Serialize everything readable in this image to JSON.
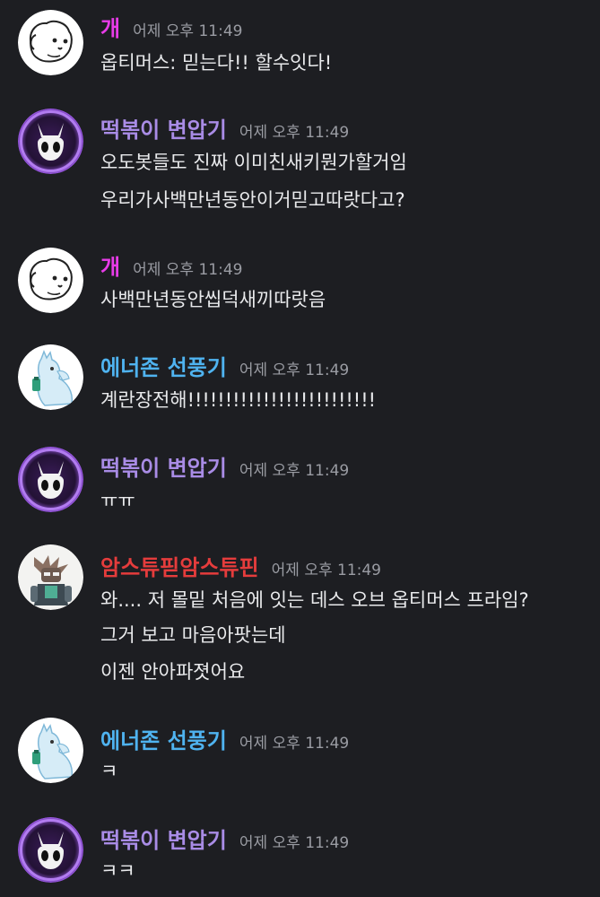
{
  "users": {
    "dog": {
      "name": "개",
      "color": "#e83ce8",
      "avatar_icon": "white-dog-face-icon"
    },
    "tteok": {
      "name": "떡볶이 변압기",
      "color": "#a98ce6",
      "avatar_icon": "hollow-knight-mask-icon"
    },
    "energon": {
      "name": "에너존 선풍기",
      "color": "#4fb3f0",
      "avatar_icon": "llama-icon"
    },
    "ams": {
      "name": "암스튜핃암스튜핀",
      "color": "#e53c3c",
      "avatar_icon": "robot-character-icon"
    }
  },
  "messages": [
    {
      "time": "어제 오후 11:49",
      "lines": [
        "옵티머스: 믿는다!! 할수잇다!"
      ]
    },
    {
      "time": "어제 오후 11:49",
      "lines": [
        "오도봇들도 진짜 이미친새키뭔가할거임",
        "우리가사백만년동안이거믿고따랏다고?"
      ]
    },
    {
      "time": "어제 오후 11:49",
      "lines": [
        "사백만년동안씹덕새끼따랏음"
      ]
    },
    {
      "time": "어제 오후 11:49",
      "lines": [
        "계란장전해!!!!!!!!!!!!!!!!!!!!!!!!!"
      ]
    },
    {
      "time": "어제 오후 11:49",
      "lines": [
        "ㅠㅠ"
      ]
    },
    {
      "time": "어제 오후 11:49",
      "lines": [
        "와.... 저 몰밑 처음에 잇는 데스 오브 옵티머스 프라임?",
        "그거 보고 마음아팟는데",
        "이젠 안아파졋어요"
      ]
    },
    {
      "time": "어제 오후 11:49",
      "lines": [
        "ㅋ"
      ]
    },
    {
      "time": "어제 오후 11:49",
      "lines": [
        "ㅋㅋ"
      ]
    }
  ]
}
